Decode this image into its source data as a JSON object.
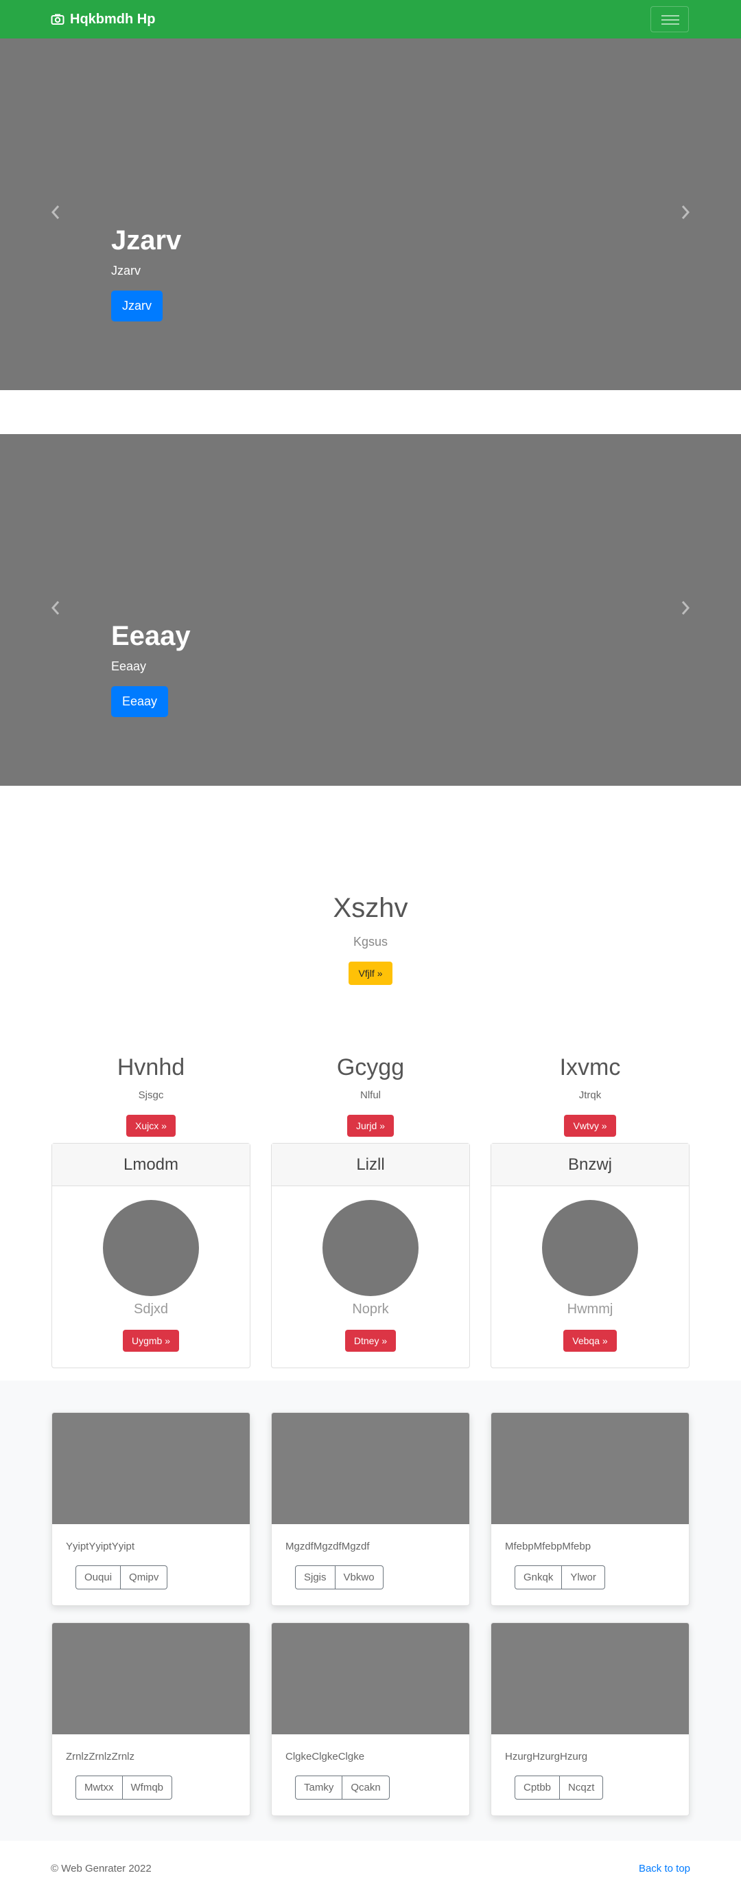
{
  "navbar": {
    "brand": "Hqkbmdh Hp",
    "brand_icon": "camera-icon",
    "accent": "#28a745"
  },
  "carousels": [
    {
      "title": "Jzarv",
      "text": "Jzarv",
      "button": "Jzarv",
      "indicator_count": 3,
      "active_index": 0
    },
    {
      "title": "Eeaay",
      "text": "Eeaay",
      "button": "Eeaay",
      "indicator_count": 3,
      "active_index": 0
    }
  ],
  "jumbotron": {
    "title": "Xszhv",
    "text": "Kgsus",
    "button": "Vfjlf »"
  },
  "columns": [
    {
      "title": "Hvnhd",
      "text": "Sjsgc",
      "button": "Xujcx »"
    },
    {
      "title": "Gcygg",
      "text": "Nlful",
      "button": "Jurjd »"
    },
    {
      "title": "Ixvmc",
      "text": "Jtrqk",
      "button": "Vwtvy »"
    }
  ],
  "cards": [
    {
      "header": "Lmodm",
      "text": "Sdjxd",
      "button": "Uygmb »"
    },
    {
      "header": "Lizll",
      "text": "Noprk",
      "button": "Dtney »"
    },
    {
      "header": "Bnzwj",
      "text": "Hwmmj",
      "button": "Vebqa »"
    }
  ],
  "album": [
    {
      "text": "YyiptYyiptYyipt",
      "btn1": "Ouqui",
      "btn2": "Qmipv"
    },
    {
      "text": "MgzdfMgzdfMgzdf",
      "btn1": "Sjgis",
      "btn2": "Vbkwo"
    },
    {
      "text": "MfebpMfebpMfebp",
      "btn1": "Gnkqk",
      "btn2": "Ylwor"
    },
    {
      "text": "ZrnlzZrnlzZrnlz",
      "btn1": "Mwtxx",
      "btn2": "Wfmqb"
    },
    {
      "text": "ClgkeClgkeClgke",
      "btn1": "Tamky",
      "btn2": "Qcakn"
    },
    {
      "text": "HzurgHzurgHzurg",
      "btn1": "Cptbb",
      "btn2": "Ncqzt"
    }
  ],
  "footer": {
    "copyright": "© Web Genrater 2022",
    "back_to_top": "Back to top"
  }
}
